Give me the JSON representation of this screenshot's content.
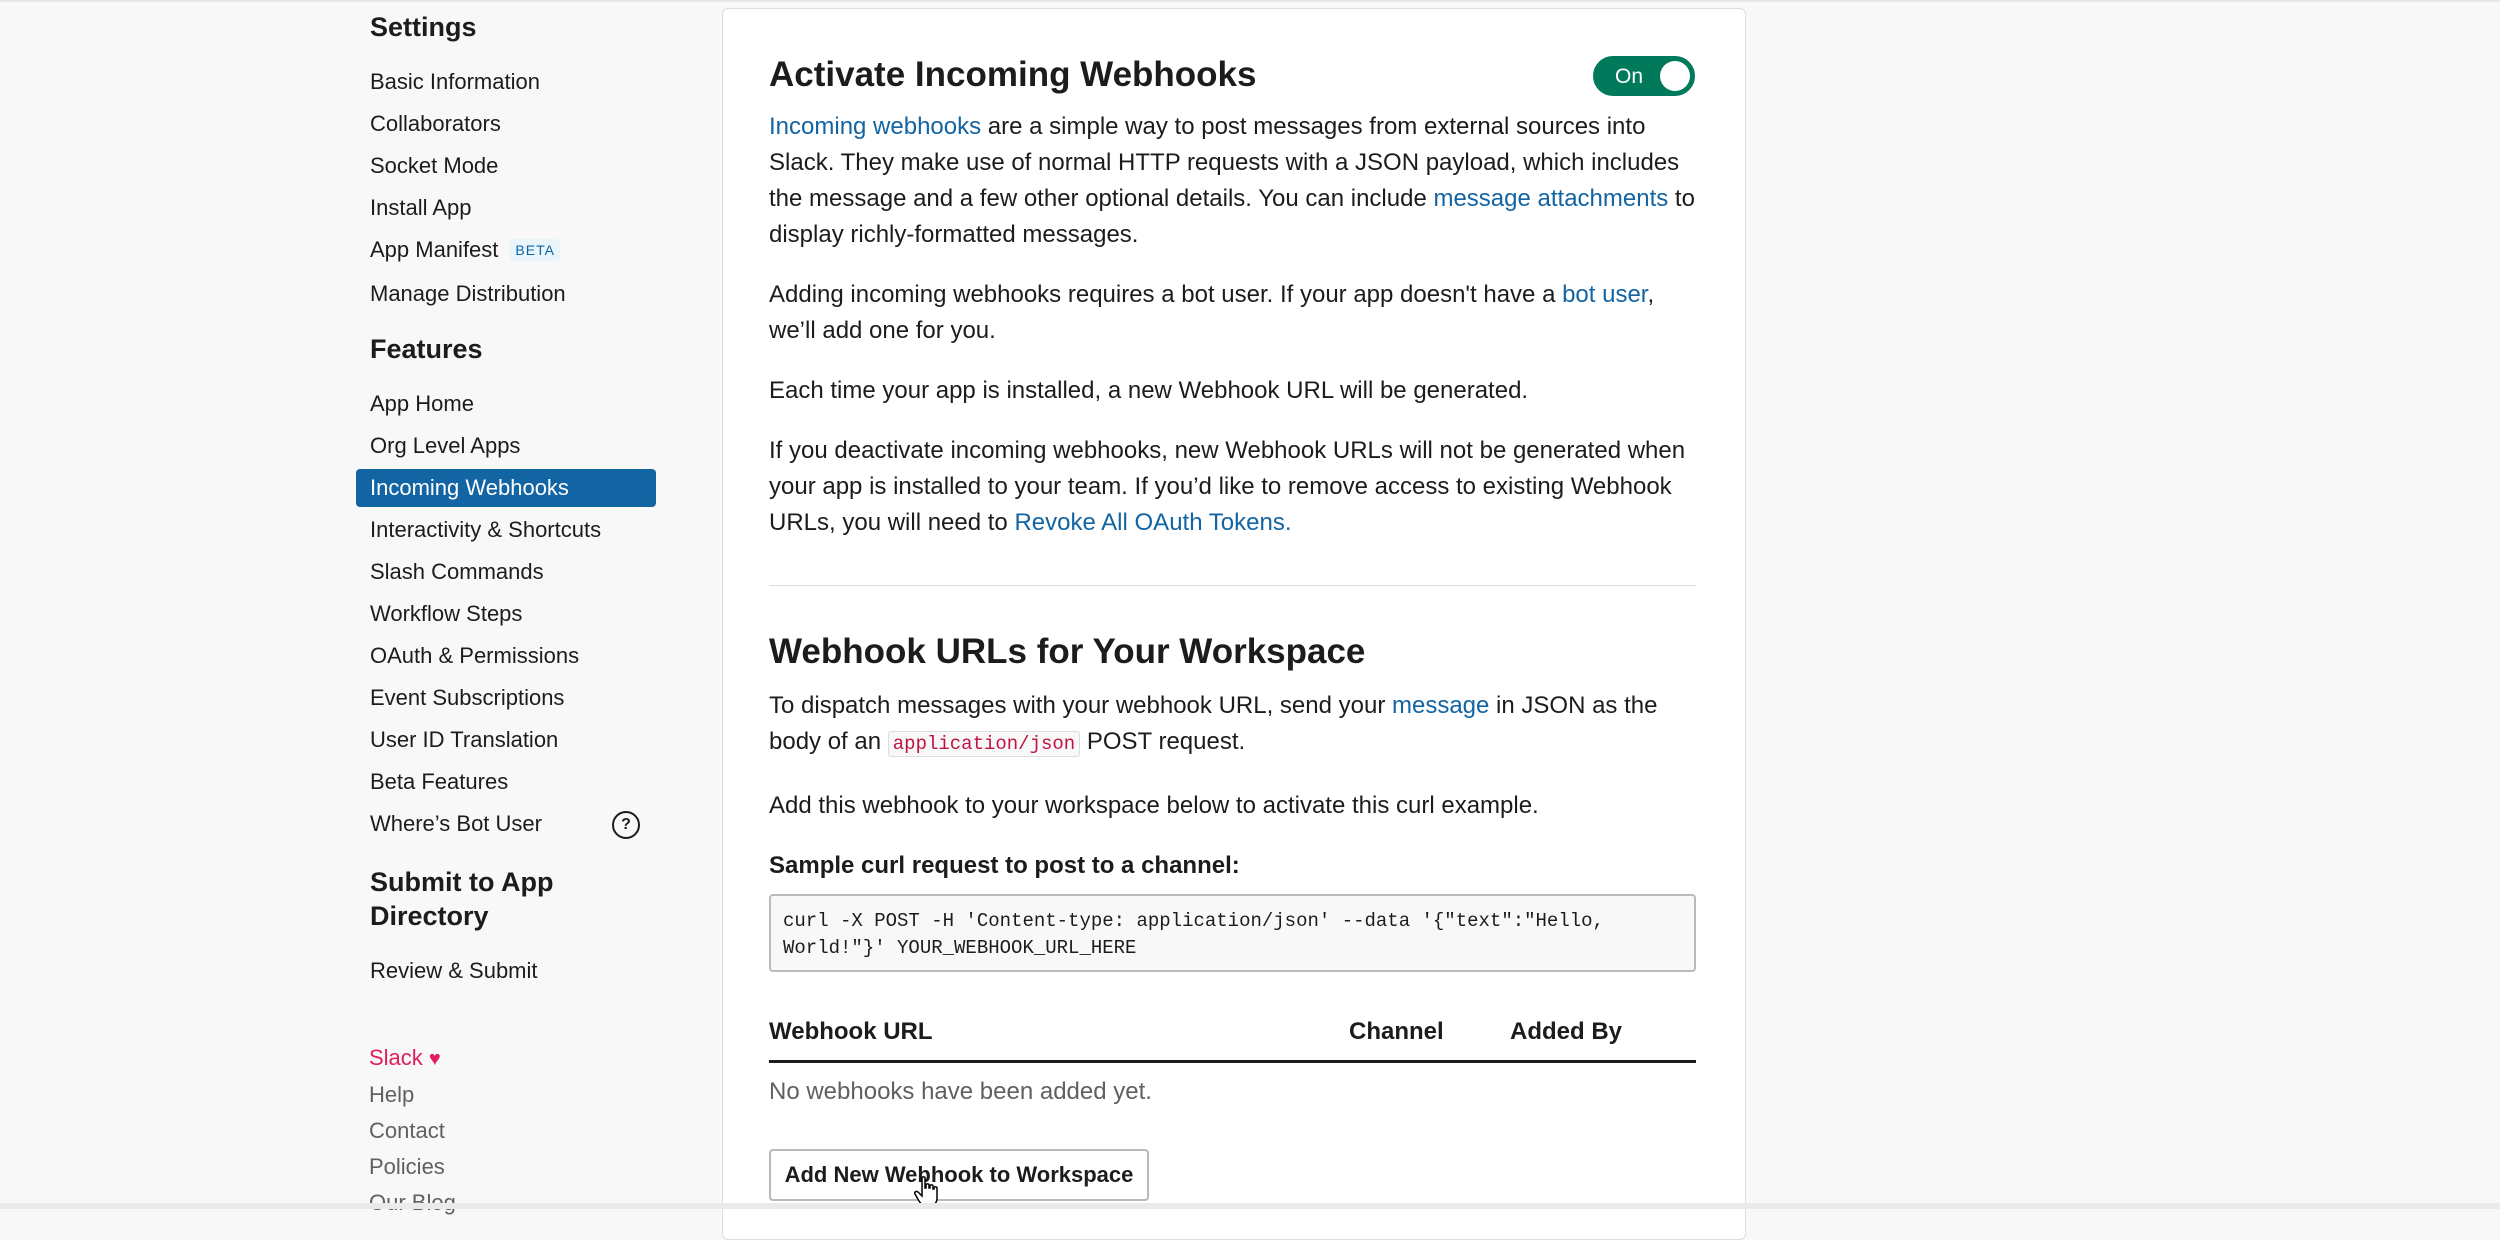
{
  "sidebar": {
    "settings_title": "Settings",
    "settings_items": [
      "Basic Information",
      "Collaborators",
      "Socket Mode",
      "Install App",
      "App Manifest",
      "Manage Distribution"
    ],
    "beta_badge": "BETA",
    "features_title": "Features",
    "features_items": [
      "App Home",
      "Org Level Apps",
      "Incoming Webhooks",
      "Interactivity & Shortcuts",
      "Slash Commands",
      "Workflow Steps",
      "OAuth & Permissions",
      "Event Subscriptions",
      "User ID Translation",
      "Beta Features",
      "Where’s Bot User"
    ],
    "active_item": "Incoming Webhooks",
    "help_icon": "?",
    "submit_title": "Submit to App Directory",
    "submit_items": [
      "Review & Submit"
    ]
  },
  "footer": {
    "slack": "Slack",
    "heart": "♥",
    "links": [
      "Help",
      "Contact",
      "Policies",
      "Our Blog"
    ]
  },
  "main": {
    "activate_title": "Activate Incoming Webhooks",
    "toggle_label": "On",
    "p1": {
      "link1": "Incoming webhooks",
      "text1": " are a simple way to post messages from external sources into Slack. They make use of normal HTTP requests with a JSON payload, which includes the message and a few other optional details. You can include ",
      "link2": "message attachments",
      "text2": " to display richly-formatted messages."
    },
    "p2": {
      "text1": "Adding incoming webhooks requires a bot user. If your app doesn't have a ",
      "link": "bot user",
      "text2": ", we’ll add one for you."
    },
    "p3": "Each time your app is installed, a new Webhook URL will be generated.",
    "p4": {
      "text": "If you deactivate incoming webhooks, new Webhook URLs will not be generated when your app is installed to your team. If you’d like to remove access to existing Webhook URLs, you will need to ",
      "link": "Revoke All OAuth Tokens."
    },
    "webhook_title": "Webhook URLs for Your Workspace",
    "p5": {
      "text1": "To dispatch messages with your webhook URL, send your ",
      "link": "message",
      "text2": " in JSON as the body of an ",
      "code": "application/json",
      "text3": " POST request."
    },
    "p6": "Add this webhook to your workspace below to activate this curl example.",
    "sample_label": "Sample curl request to post to a channel:",
    "curl": "curl -X POST -H 'Content-type: application/json' --data '{\"text\":\"Hello, World!\"}' YOUR_WEBHOOK_URL_HERE",
    "table": {
      "headers": [
        "Webhook URL",
        "Channel",
        "Added By"
      ],
      "empty": "No webhooks have been added yet."
    },
    "add_button": "Add New Webhook to Workspace"
  },
  "colors": {
    "link": "#1264a3",
    "active_nav": "#1264a3",
    "toggle": "#007a5a",
    "code": "#c01343",
    "slack_brand": "#e01e5a"
  }
}
